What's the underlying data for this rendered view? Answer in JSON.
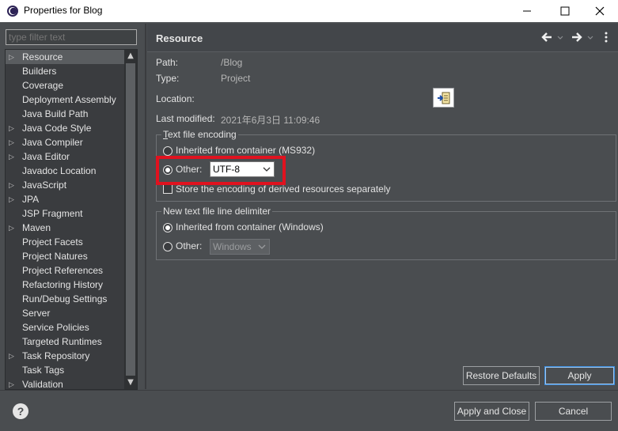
{
  "window": {
    "title": "Properties for Blog"
  },
  "filter": {
    "placeholder": "type filter text"
  },
  "tree": {
    "items": [
      {
        "label": "Resource",
        "expandable": true,
        "selected": true
      },
      {
        "label": "Builders",
        "expandable": false
      },
      {
        "label": "Coverage",
        "expandable": false
      },
      {
        "label": "Deployment Assembly",
        "expandable": false
      },
      {
        "label": "Java Build Path",
        "expandable": false
      },
      {
        "label": "Java Code Style",
        "expandable": true
      },
      {
        "label": "Java Compiler",
        "expandable": true
      },
      {
        "label": "Java Editor",
        "expandable": true
      },
      {
        "label": "Javadoc Location",
        "expandable": false
      },
      {
        "label": "JavaScript",
        "expandable": true
      },
      {
        "label": "JPA",
        "expandable": true
      },
      {
        "label": "JSP Fragment",
        "expandable": false
      },
      {
        "label": "Maven",
        "expandable": true
      },
      {
        "label": "Project Facets",
        "expandable": false
      },
      {
        "label": "Project Natures",
        "expandable": false
      },
      {
        "label": "Project References",
        "expandable": false
      },
      {
        "label": "Refactoring History",
        "expandable": false
      },
      {
        "label": "Run/Debug Settings",
        "expandable": false
      },
      {
        "label": "Server",
        "expandable": false
      },
      {
        "label": "Service Policies",
        "expandable": false
      },
      {
        "label": "Targeted Runtimes",
        "expandable": false
      },
      {
        "label": "Task Repository",
        "expandable": true
      },
      {
        "label": "Task Tags",
        "expandable": false
      },
      {
        "label": "Validation",
        "expandable": true
      }
    ]
  },
  "page": {
    "title": "Resource",
    "path_label": "Path:",
    "path_value": "/Blog",
    "type_label": "Type:",
    "type_value": "Project",
    "location_label": "Location:",
    "modified_label": "Last modified:",
    "modified_value": "2021年6月3日 11:09:46"
  },
  "encoding": {
    "group_title": "Text file encoding",
    "inherited_label": "Inherited from container (MS932)",
    "other_label": "Other:",
    "other_value": "UTF-8",
    "store_label": "Store the encoding of derived resources separately"
  },
  "delimiter": {
    "group_title": "New text file line delimiter",
    "inherited_label": "Inherited from container (Windows)",
    "other_label": "Other:",
    "other_value": "Windows"
  },
  "buttons": {
    "restore_defaults": "Restore Defaults",
    "apply": "Apply",
    "apply_and_close": "Apply and Close",
    "cancel": "Cancel",
    "help": "?"
  }
}
